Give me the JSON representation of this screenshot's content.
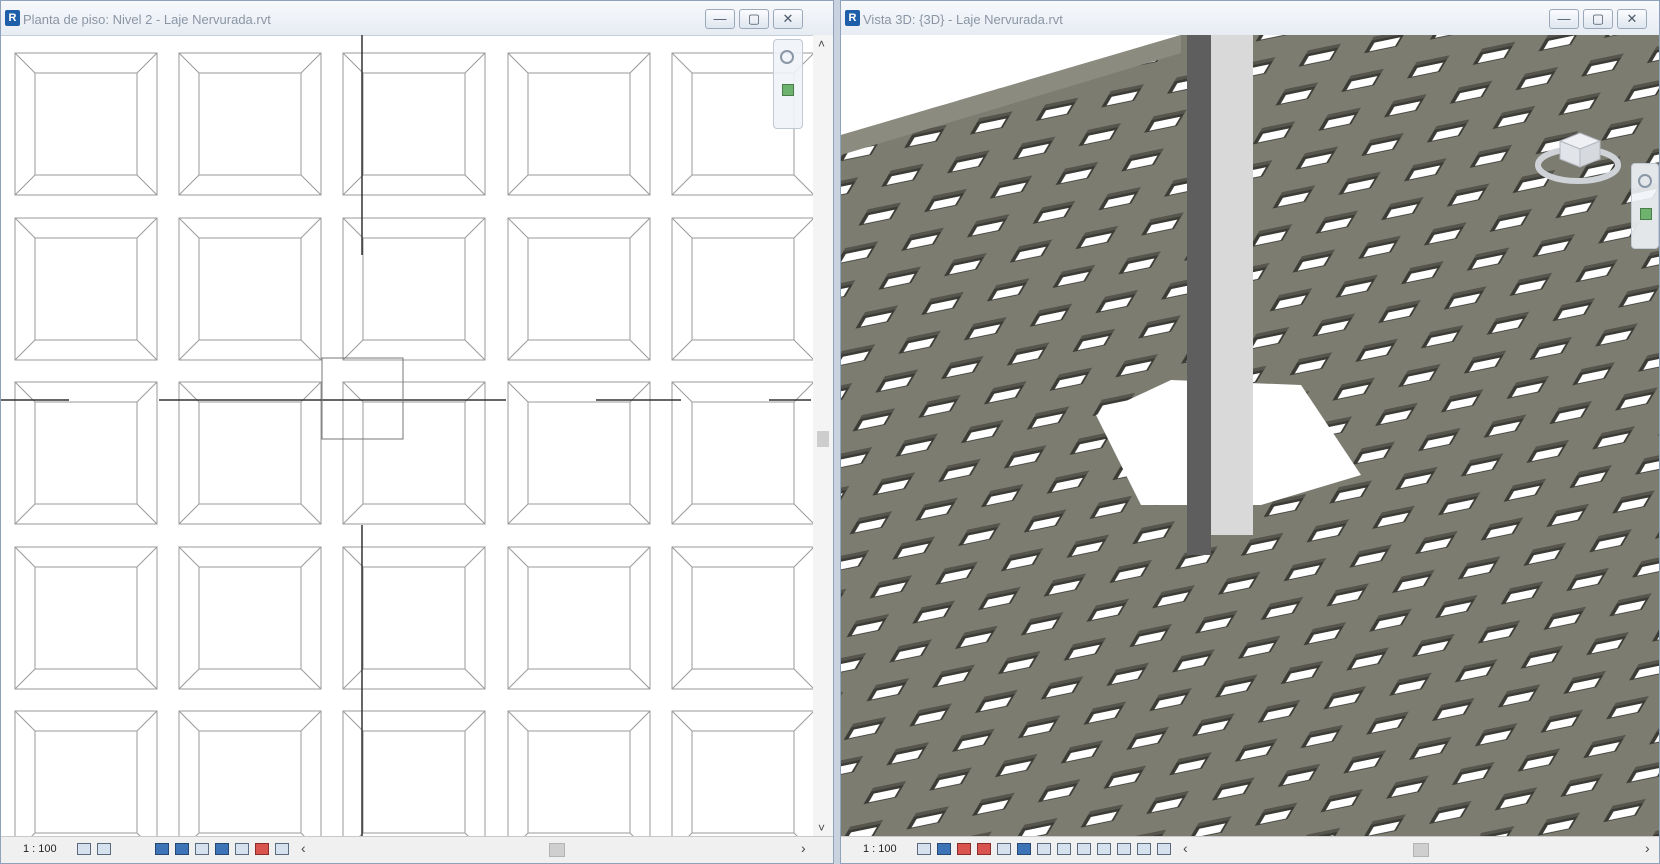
{
  "plan_window": {
    "title": "Planta de piso: Nivel 2 - Laje Nervurada.rvt",
    "app_icon": "R",
    "minimize_icon": "minimize-icon",
    "restore_icon": "restore-icon",
    "close_icon": "close-icon",
    "scale": "1 : 100"
  },
  "view3d_window": {
    "title": "Vista 3D: {3D} - Laje Nervurada.rvt",
    "app_icon": "R",
    "minimize_icon": "minimize-icon",
    "restore_icon": "restore-icon",
    "close_icon": "close-icon",
    "scale": "1 : 100"
  },
  "symbols": {
    "minimize": "—",
    "restore": "▢",
    "close": "✕",
    "left_arrow": "‹",
    "right_arrow": "›",
    "up_arrow": "˄",
    "down_arrow": "˅"
  },
  "colors": {
    "slab": "#7f7f74",
    "slab_dark": "#56564e",
    "rib_light": "#9a9a8e",
    "column": "#5c5c5c",
    "column_face": "#d8d8d8"
  }
}
